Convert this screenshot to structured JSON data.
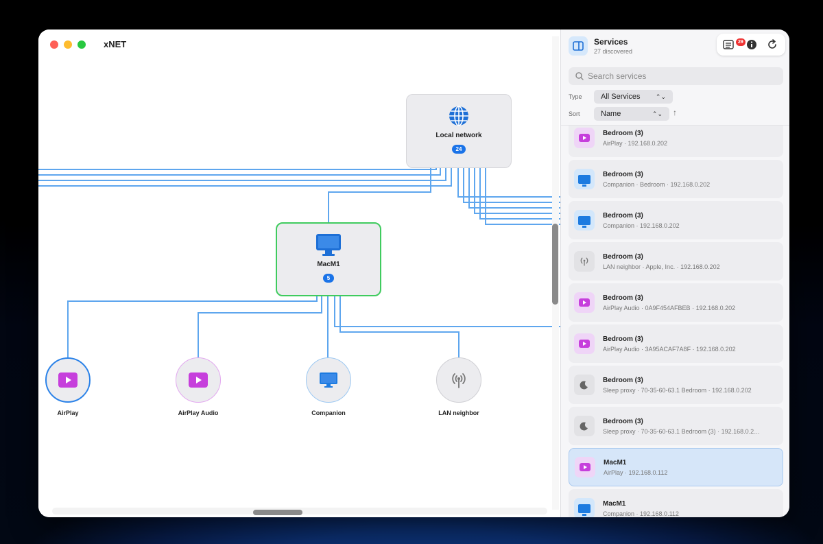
{
  "window": {
    "title": "xNET"
  },
  "graph": {
    "local_network": {
      "label": "Local network",
      "count": "24"
    },
    "mac_node": {
      "label": "MacM1",
      "count": "5"
    },
    "leaves": [
      {
        "label": "AirPlay",
        "icon": "airplay-icon"
      },
      {
        "label": "AirPlay Audio",
        "icon": "airplay-icon"
      },
      {
        "label": "Companion",
        "icon": "monitor-icon"
      },
      {
        "label": "LAN neighbor",
        "icon": "antenna-icon"
      }
    ]
  },
  "sidebar": {
    "title": "Services",
    "subtitle": "27 discovered",
    "notification_count": "29",
    "search_placeholder": "Search services",
    "type_label": "Type",
    "type_value": "All Services",
    "sort_label": "Sort",
    "sort_value": "Name",
    "sort_direction": "↑",
    "items": [
      {
        "name": "Bedroom (3)",
        "detail": "AirPlay · 192.168.0.202",
        "icon": "airplay-icon"
      },
      {
        "name": "Bedroom (3)",
        "detail": "Companion · Bedroom · 192.168.0.202",
        "icon": "monitor-icon"
      },
      {
        "name": "Bedroom (3)",
        "detail": "Companion · 192.168.0.202",
        "icon": "monitor-icon"
      },
      {
        "name": "Bedroom (3)",
        "detail": "LAN neighbor · Apple, Inc. · 192.168.0.202",
        "icon": "antenna-icon"
      },
      {
        "name": "Bedroom (3)",
        "detail": "AirPlay Audio · 0A9F454AFBEB · 192.168.0.202",
        "icon": "airplay-icon"
      },
      {
        "name": "Bedroom (3)",
        "detail": "AirPlay Audio · 3A95ACAF7A8F · 192.168.0.202",
        "icon": "airplay-icon"
      },
      {
        "name": "Bedroom (3)",
        "detail": "Sleep proxy · 70-35-60-63.1 Bedroom · 192.168.0.202",
        "icon": "moon-icon"
      },
      {
        "name": "Bedroom (3)",
        "detail": "Sleep proxy · 70-35-60-63.1 Bedroom (3) · 192.168.0.2…",
        "icon": "moon-icon"
      },
      {
        "name": "MacM1",
        "detail": "AirPlay · 192.168.0.112",
        "icon": "airplay-icon"
      },
      {
        "name": "MacM1",
        "detail": "Companion · 192.168.0.112",
        "icon": "monitor-icon"
      }
    ]
  }
}
